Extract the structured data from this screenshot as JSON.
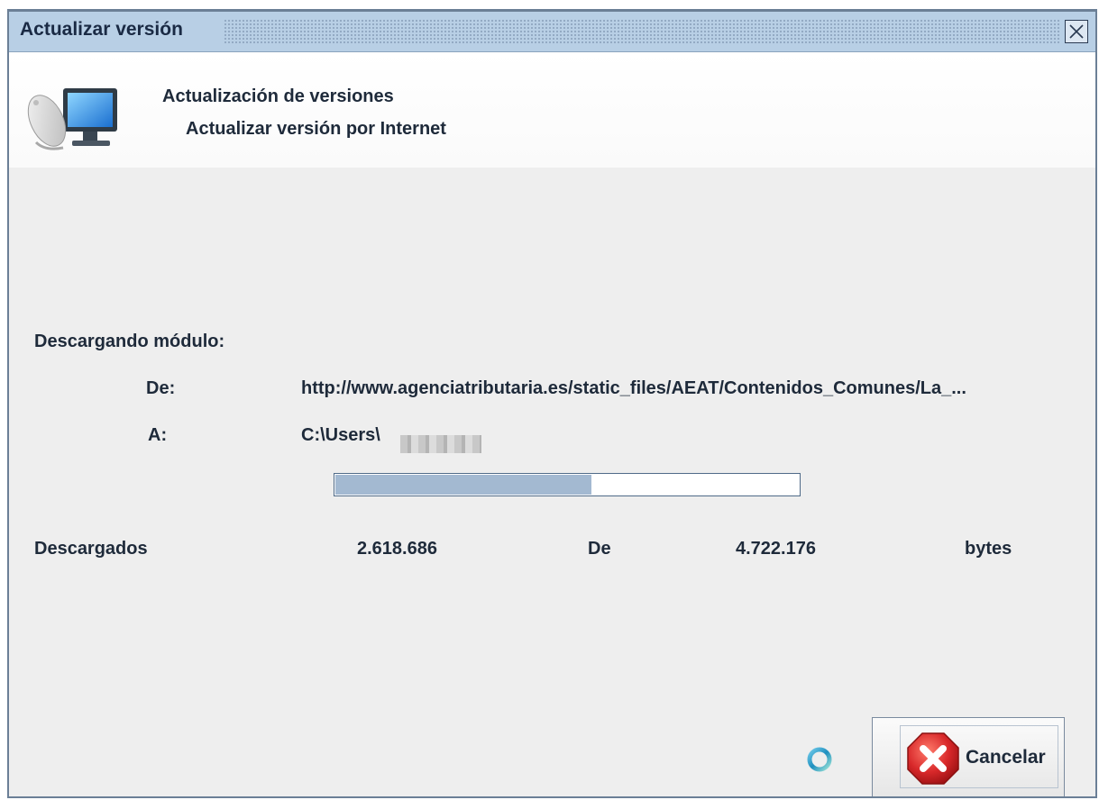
{
  "window": {
    "title": "Actualizar versión"
  },
  "header": {
    "title": "Actualización de versiones",
    "subtitle": "Actualizar versión por Internet",
    "icon": "computer-network-icon"
  },
  "download": {
    "section_label": "Descargando módulo:",
    "from_label": "De:",
    "from_value": "http://www.agenciatributaria.es/static_files/AEAT/Contenidos_Comunes/La_...",
    "to_label": "A:",
    "to_value": "C:\\Users\\",
    "progress_fraction": 0.5546
  },
  "stats": {
    "downloaded_label": "Descargados",
    "downloaded_value": "2.618.686",
    "of_label": "De",
    "total_value": "4.722.176",
    "unit": "bytes"
  },
  "buttons": {
    "cancel_label": "Cancelar"
  },
  "colors": {
    "titlebar": "#b8cfe5",
    "progress_fill": "#a3b9d1",
    "cancel_red": "#d8282a"
  }
}
